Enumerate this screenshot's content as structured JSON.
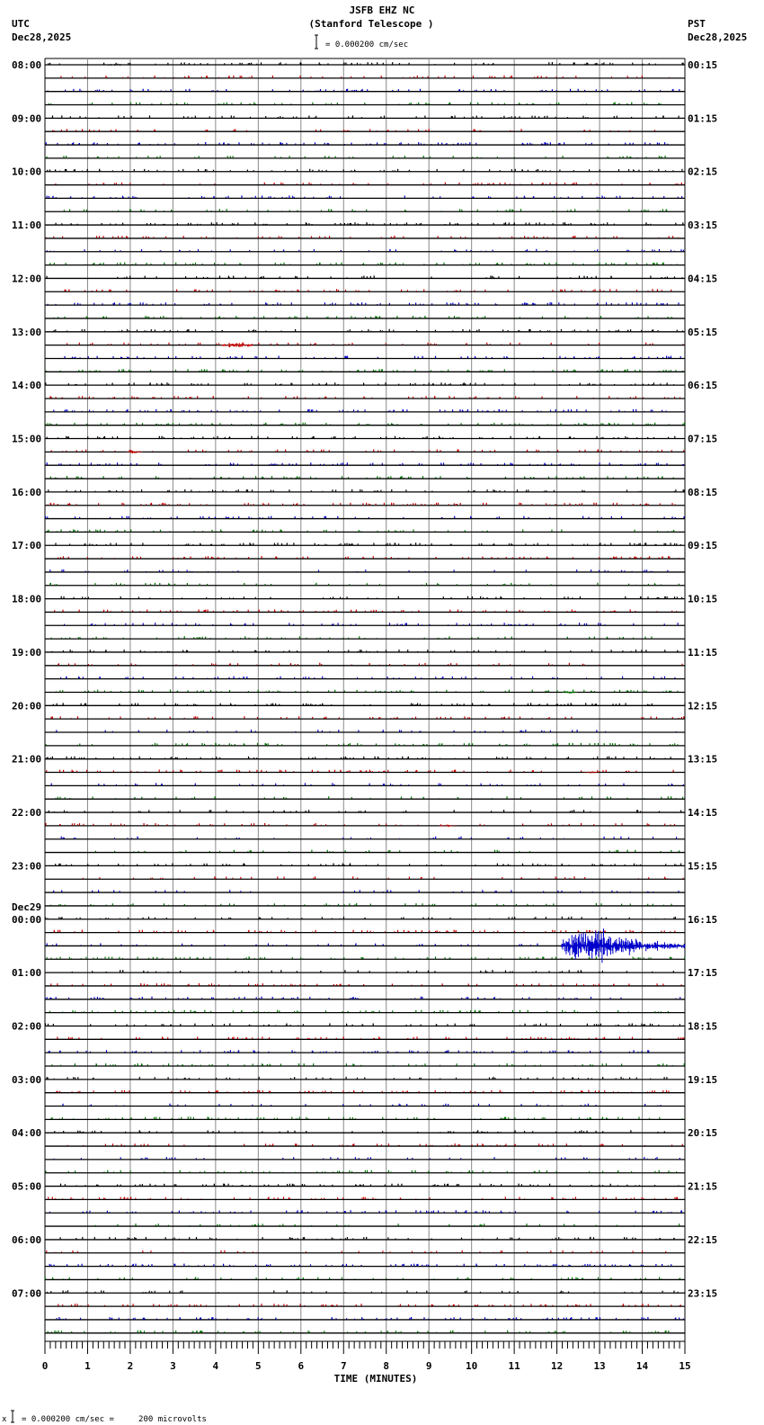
{
  "header": {
    "station": "JSFB EHZ NC",
    "location": "(Stanford Telescope )",
    "left_tz": "UTC",
    "left_date": "Dec28,2025",
    "right_tz": "PST",
    "right_date": "Dec28,2025",
    "scale": "= 0.000200 cm/sec"
  },
  "footer": {
    "marker": "x",
    "scale": "= 0.000200 cm/sec =     200 microvolts"
  },
  "chart_data": {
    "type": "line",
    "title": "JSFB EHZ NC (Stanford Telescope )",
    "xlabel": "TIME (MINUTES)",
    "xlim": [
      0,
      15
    ],
    "x_ticks": [
      "0",
      "1",
      "2",
      "3",
      "4",
      "5",
      "6",
      "7",
      "8",
      "9",
      "10",
      "11",
      "12",
      "13",
      "14",
      "15"
    ],
    "traces_per_hour": 4,
    "trace_count": 96,
    "trace_colors": [
      "#000000",
      "#cc0000",
      "#0000cc",
      "#007700"
    ],
    "left_labels": [
      "08:00",
      "09:00",
      "10:00",
      "11:00",
      "12:00",
      "13:00",
      "14:00",
      "15:00",
      "16:00",
      "17:00",
      "18:00",
      "19:00",
      "20:00",
      "21:00",
      "22:00",
      "23:00",
      "00:00",
      "01:00",
      "02:00",
      "03:00",
      "04:00",
      "05:00",
      "06:00",
      "07:00"
    ],
    "date_change_label": {
      "hour_index": 16,
      "text": "Dec29"
    },
    "right_labels": [
      "00:15",
      "01:15",
      "02:15",
      "03:15",
      "04:15",
      "05:15",
      "06:15",
      "07:15",
      "08:15",
      "09:15",
      "10:15",
      "11:15",
      "12:15",
      "13:15",
      "14:15",
      "15:15",
      "16:15",
      "17:15",
      "18:15",
      "19:15",
      "20:15",
      "21:15",
      "22:15",
      "23:15"
    ],
    "events": [
      {
        "trace": 0,
        "start_min": 1.2,
        "end_min": 2.0,
        "amplitude": 1.5
      },
      {
        "trace": 21,
        "start_min": 4.1,
        "end_min": 4.9,
        "amplitude": 4
      },
      {
        "trace": 29,
        "start_min": 1.9,
        "end_min": 2.3,
        "amplitude": 2
      },
      {
        "trace": 47,
        "start_min": 12.1,
        "end_min": 12.5,
        "amplitude": 2
      },
      {
        "trace": 48,
        "start_min": 6.1,
        "end_min": 6.4,
        "amplitude": 1.5
      },
      {
        "trace": 53,
        "start_min": 12.6,
        "end_min": 13.0,
        "amplitude": 1.5
      },
      {
        "trace": 57,
        "start_min": 9.2,
        "end_min": 9.7,
        "amplitude": 1.5
      },
      {
        "trace": 66,
        "start_min": 12.1,
        "end_min": 15.0,
        "peak_min": 13.1,
        "amplitude": 22
      }
    ]
  }
}
